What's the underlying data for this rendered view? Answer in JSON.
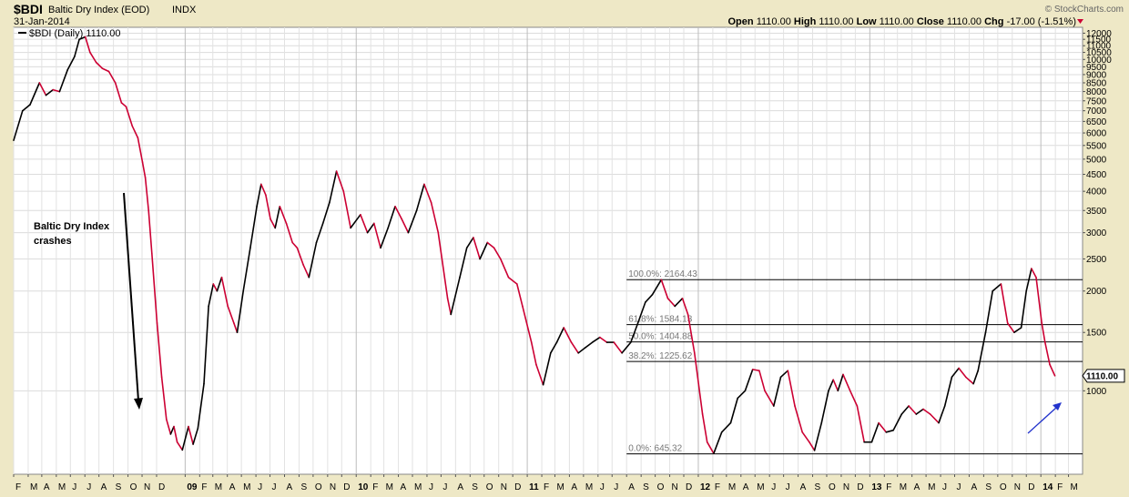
{
  "header": {
    "symbol": "$BDI",
    "name": "Baltic Dry Index (EOD)",
    "exchange": "INDX",
    "date": "31-Jan-2014",
    "watermark": "© StockCharts.com",
    "quote": {
      "open_label": "Open",
      "open": "1110.00",
      "high_label": "High",
      "high": "1110.00",
      "low_label": "Low",
      "low": "1110.00",
      "close_label": "Close",
      "close": "1110.00",
      "chg_label": "Chg",
      "chg": "-17.00 (-1.51%)"
    }
  },
  "legend": {
    "label": "$BDI (Daily) 1110.00"
  },
  "annotation": {
    "line1": "Baltic Dry Index",
    "line2": "crashes"
  },
  "last_value_tag": "1110.00",
  "chart_data": {
    "type": "line",
    "y_scale": "log",
    "ylim": [
      560,
      12500
    ],
    "xlim": [
      "2008-01-01",
      "2014-03-31"
    ],
    "y_ticks": [
      1000,
      1500,
      2000,
      2500,
      3000,
      3500,
      4000,
      4500,
      5000,
      5500,
      6000,
      6500,
      7000,
      7500,
      8000,
      8500,
      9000,
      9500,
      10000,
      10500,
      11000,
      11500,
      12000
    ],
    "x_ticks": [
      {
        "date": "2008-01-01",
        "label": "F"
      },
      {
        "date": "2008-02-01",
        "label": "M"
      },
      {
        "date": "2008-03-01",
        "label": "A"
      },
      {
        "date": "2008-04-01",
        "label": "M"
      },
      {
        "date": "2008-05-01",
        "label": "J"
      },
      {
        "date": "2008-06-01",
        "label": "J"
      },
      {
        "date": "2008-07-01",
        "label": "A"
      },
      {
        "date": "2008-08-01",
        "label": "S"
      },
      {
        "date": "2008-09-01",
        "label": "O"
      },
      {
        "date": "2008-10-01",
        "label": "N"
      },
      {
        "date": "2008-11-01",
        "label": "D"
      },
      {
        "date": "2009-01-01",
        "label": "09",
        "bold": true
      },
      {
        "date": "2009-02-01",
        "label": "F"
      },
      {
        "date": "2009-03-01",
        "label": "M"
      },
      {
        "date": "2009-04-01",
        "label": "A"
      },
      {
        "date": "2009-05-01",
        "label": "M"
      },
      {
        "date": "2009-06-01",
        "label": "J"
      },
      {
        "date": "2009-07-01",
        "label": "J"
      },
      {
        "date": "2009-08-01",
        "label": "A"
      },
      {
        "date": "2009-09-01",
        "label": "S"
      },
      {
        "date": "2009-10-01",
        "label": "O"
      },
      {
        "date": "2009-11-01",
        "label": "N"
      },
      {
        "date": "2009-12-01",
        "label": "D"
      },
      {
        "date": "2010-01-01",
        "label": "10",
        "bold": true
      },
      {
        "date": "2010-02-01",
        "label": "F"
      },
      {
        "date": "2010-03-01",
        "label": "M"
      },
      {
        "date": "2010-04-01",
        "label": "A"
      },
      {
        "date": "2010-05-01",
        "label": "M"
      },
      {
        "date": "2010-06-01",
        "label": "J"
      },
      {
        "date": "2010-07-01",
        "label": "J"
      },
      {
        "date": "2010-08-01",
        "label": "A"
      },
      {
        "date": "2010-09-01",
        "label": "S"
      },
      {
        "date": "2010-10-01",
        "label": "O"
      },
      {
        "date": "2010-11-01",
        "label": "N"
      },
      {
        "date": "2010-12-01",
        "label": "D"
      },
      {
        "date": "2011-01-01",
        "label": "11",
        "bold": true
      },
      {
        "date": "2011-02-01",
        "label": "F"
      },
      {
        "date": "2011-03-01",
        "label": "M"
      },
      {
        "date": "2011-04-01",
        "label": "A"
      },
      {
        "date": "2011-05-01",
        "label": "M"
      },
      {
        "date": "2011-06-01",
        "label": "J"
      },
      {
        "date": "2011-07-01",
        "label": "J"
      },
      {
        "date": "2011-08-01",
        "label": "A"
      },
      {
        "date": "2011-09-01",
        "label": "S"
      },
      {
        "date": "2011-10-01",
        "label": "O"
      },
      {
        "date": "2011-11-01",
        "label": "N"
      },
      {
        "date": "2011-12-01",
        "label": "D"
      },
      {
        "date": "2012-01-01",
        "label": "12",
        "bold": true
      },
      {
        "date": "2012-02-01",
        "label": "F"
      },
      {
        "date": "2012-03-01",
        "label": "M"
      },
      {
        "date": "2012-04-01",
        "label": "A"
      },
      {
        "date": "2012-05-01",
        "label": "M"
      },
      {
        "date": "2012-06-01",
        "label": "J"
      },
      {
        "date": "2012-07-01",
        "label": "J"
      },
      {
        "date": "2012-08-01",
        "label": "A"
      },
      {
        "date": "2012-09-01",
        "label": "S"
      },
      {
        "date": "2012-10-01",
        "label": "O"
      },
      {
        "date": "2012-11-01",
        "label": "N"
      },
      {
        "date": "2012-12-01",
        "label": "D"
      },
      {
        "date": "2013-01-01",
        "label": "13",
        "bold": true
      },
      {
        "date": "2013-02-01",
        "label": "F"
      },
      {
        "date": "2013-03-01",
        "label": "M"
      },
      {
        "date": "2013-04-01",
        "label": "A"
      },
      {
        "date": "2013-05-01",
        "label": "M"
      },
      {
        "date": "2013-06-01",
        "label": "J"
      },
      {
        "date": "2013-07-01",
        "label": "J"
      },
      {
        "date": "2013-08-01",
        "label": "A"
      },
      {
        "date": "2013-09-01",
        "label": "S"
      },
      {
        "date": "2013-10-01",
        "label": "O"
      },
      {
        "date": "2013-11-01",
        "label": "N"
      },
      {
        "date": "2013-12-01",
        "label": "D"
      },
      {
        "date": "2014-01-01",
        "label": "14",
        "bold": true
      },
      {
        "date": "2014-02-01",
        "label": "F"
      },
      {
        "date": "2014-03-01",
        "label": "M"
      }
    ],
    "fib_levels": [
      {
        "label": "100.0%: 2164.43",
        "value": 2164.43,
        "start": "2011-08-01"
      },
      {
        "label": "61.8%: 1584.13",
        "value": 1584.13,
        "start": "2011-08-01"
      },
      {
        "label": "50.0%: 1404.88",
        "value": 1404.88,
        "start": "2011-08-01"
      },
      {
        "label": "38.2%: 1225.62",
        "value": 1225.62,
        "start": "2011-08-01"
      },
      {
        "label": "0.0%: 645.32",
        "value": 645.32,
        "start": "2011-08-01"
      }
    ],
    "series": [
      {
        "up_color": "#000000",
        "down_color": "#cc0033",
        "points": [
          [
            "2008-01-01",
            5700
          ],
          [
            "2008-01-20",
            7000
          ],
          [
            "2008-02-05",
            7300
          ],
          [
            "2008-02-25",
            8500
          ],
          [
            "2008-03-10",
            7800
          ],
          [
            "2008-03-25",
            8100
          ],
          [
            "2008-04-08",
            8000
          ],
          [
            "2008-04-25",
            9300
          ],
          [
            "2008-05-10",
            10200
          ],
          [
            "2008-05-20",
            11500
          ],
          [
            "2008-06-02",
            11700
          ],
          [
            "2008-06-12",
            10500
          ],
          [
            "2008-06-25",
            9800
          ],
          [
            "2008-07-08",
            9400
          ],
          [
            "2008-07-22",
            9200
          ],
          [
            "2008-08-05",
            8500
          ],
          [
            "2008-08-18",
            7400
          ],
          [
            "2008-08-28",
            7200
          ],
          [
            "2008-09-10",
            6300
          ],
          [
            "2008-09-22",
            5800
          ],
          [
            "2008-10-02",
            4900
          ],
          [
            "2008-10-08",
            4400
          ],
          [
            "2008-10-15",
            3500
          ],
          [
            "2008-10-22",
            2600
          ],
          [
            "2008-11-02",
            1600
          ],
          [
            "2008-11-12",
            1100
          ],
          [
            "2008-11-22",
            820
          ],
          [
            "2008-12-01",
            740
          ],
          [
            "2008-12-08",
            780
          ],
          [
            "2008-12-15",
            700
          ],
          [
            "2008-12-26",
            663
          ],
          [
            "2009-01-08",
            780
          ],
          [
            "2009-01-18",
            690
          ],
          [
            "2009-01-28",
            770
          ],
          [
            "2009-02-10",
            1050
          ],
          [
            "2009-02-20",
            1800
          ],
          [
            "2009-03-02",
            2100
          ],
          [
            "2009-03-10",
            2000
          ],
          [
            "2009-03-20",
            2200
          ],
          [
            "2009-04-02",
            1800
          ],
          [
            "2009-04-15",
            1600
          ],
          [
            "2009-04-22",
            1500
          ],
          [
            "2009-05-05",
            2000
          ],
          [
            "2009-05-20",
            2700
          ],
          [
            "2009-06-03",
            3600
          ],
          [
            "2009-06-12",
            4200
          ],
          [
            "2009-06-22",
            3900
          ],
          [
            "2009-07-02",
            3300
          ],
          [
            "2009-07-12",
            3100
          ],
          [
            "2009-07-22",
            3600
          ],
          [
            "2009-08-05",
            3200
          ],
          [
            "2009-08-18",
            2800
          ],
          [
            "2009-08-28",
            2700
          ],
          [
            "2009-09-10",
            2400
          ],
          [
            "2009-09-22",
            2200
          ],
          [
            "2009-10-08",
            2800
          ],
          [
            "2009-10-22",
            3200
          ],
          [
            "2009-11-05",
            3700
          ],
          [
            "2009-11-20",
            4600
          ],
          [
            "2009-12-05",
            4000
          ],
          [
            "2009-12-20",
            3100
          ],
          [
            "2010-01-10",
            3400
          ],
          [
            "2010-01-25",
            3000
          ],
          [
            "2010-02-08",
            3200
          ],
          [
            "2010-02-22",
            2700
          ],
          [
            "2010-03-10",
            3100
          ],
          [
            "2010-03-25",
            3600
          ],
          [
            "2010-04-08",
            3300
          ],
          [
            "2010-04-22",
            3000
          ],
          [
            "2010-05-10",
            3500
          ],
          [
            "2010-05-26",
            4200
          ],
          [
            "2010-06-10",
            3700
          ],
          [
            "2010-06-25",
            3000
          ],
          [
            "2010-07-15",
            1900
          ],
          [
            "2010-07-22",
            1700
          ],
          [
            "2010-08-10",
            2200
          ],
          [
            "2010-08-25",
            2700
          ],
          [
            "2010-09-08",
            2900
          ],
          [
            "2010-09-22",
            2500
          ],
          [
            "2010-10-08",
            2800
          ],
          [
            "2010-10-22",
            2700
          ],
          [
            "2010-11-05",
            2500
          ],
          [
            "2010-11-22",
            2200
          ],
          [
            "2010-12-10",
            2100
          ],
          [
            "2010-12-22",
            1800
          ],
          [
            "2011-01-10",
            1400
          ],
          [
            "2011-01-20",
            1200
          ],
          [
            "2011-02-04",
            1043
          ],
          [
            "2011-02-20",
            1300
          ],
          [
            "2011-03-05",
            1400
          ],
          [
            "2011-03-20",
            1550
          ],
          [
            "2011-04-05",
            1400
          ],
          [
            "2011-04-20",
            1300
          ],
          [
            "2011-05-05",
            1350
          ],
          [
            "2011-05-20",
            1400
          ],
          [
            "2011-06-05",
            1450
          ],
          [
            "2011-06-20",
            1400
          ],
          [
            "2011-07-05",
            1400
          ],
          [
            "2011-07-22",
            1300
          ],
          [
            "2011-08-10",
            1400
          ],
          [
            "2011-08-25",
            1600
          ],
          [
            "2011-09-10",
            1850
          ],
          [
            "2011-09-25",
            1950
          ],
          [
            "2011-10-14",
            2164
          ],
          [
            "2011-10-28",
            1900
          ],
          [
            "2011-11-12",
            1800
          ],
          [
            "2011-11-28",
            1900
          ],
          [
            "2011-12-10",
            1700
          ],
          [
            "2011-12-24",
            1300
          ],
          [
            "2012-01-10",
            850
          ],
          [
            "2012-01-20",
            700
          ],
          [
            "2012-02-03",
            647
          ],
          [
            "2012-02-20",
            750
          ],
          [
            "2012-03-10",
            800
          ],
          [
            "2012-03-25",
            950
          ],
          [
            "2012-04-10",
            1000
          ],
          [
            "2012-04-26",
            1160
          ],
          [
            "2012-05-10",
            1150
          ],
          [
            "2012-05-22",
            1000
          ],
          [
            "2012-06-10",
            900
          ],
          [
            "2012-06-25",
            1100
          ],
          [
            "2012-07-10",
            1150
          ],
          [
            "2012-07-25",
            900
          ],
          [
            "2012-08-10",
            750
          ],
          [
            "2012-08-25",
            700
          ],
          [
            "2012-09-05",
            661
          ],
          [
            "2012-09-20",
            800
          ],
          [
            "2012-10-05",
            1000
          ],
          [
            "2012-10-15",
            1080
          ],
          [
            "2012-10-25",
            1000
          ],
          [
            "2012-11-05",
            1120
          ],
          [
            "2012-11-20",
            1000
          ],
          [
            "2012-12-05",
            900
          ],
          [
            "2012-12-20",
            700
          ],
          [
            "2013-01-05",
            700
          ],
          [
            "2013-01-20",
            800
          ],
          [
            "2013-02-05",
            750
          ],
          [
            "2013-02-20",
            760
          ],
          [
            "2013-03-10",
            850
          ],
          [
            "2013-03-25",
            900
          ],
          [
            "2013-04-10",
            850
          ],
          [
            "2013-04-25",
            880
          ],
          [
            "2013-05-10",
            850
          ],
          [
            "2013-05-28",
            800
          ],
          [
            "2013-06-10",
            900
          ],
          [
            "2013-06-25",
            1100
          ],
          [
            "2013-07-10",
            1170
          ],
          [
            "2013-07-25",
            1100
          ],
          [
            "2013-08-10",
            1050
          ],
          [
            "2013-08-20",
            1150
          ],
          [
            "2013-09-05",
            1500
          ],
          [
            "2013-09-20",
            2000
          ],
          [
            "2013-10-08",
            2100
          ],
          [
            "2013-10-22",
            1600
          ],
          [
            "2013-11-05",
            1500
          ],
          [
            "2013-11-20",
            1550
          ],
          [
            "2013-12-01",
            2000
          ],
          [
            "2013-12-12",
            2337
          ],
          [
            "2013-12-22",
            2200
          ],
          [
            "2014-01-03",
            1600
          ],
          [
            "2014-01-10",
            1400
          ],
          [
            "2014-01-20",
            1200
          ],
          [
            "2014-01-31",
            1110
          ]
        ]
      }
    ]
  }
}
